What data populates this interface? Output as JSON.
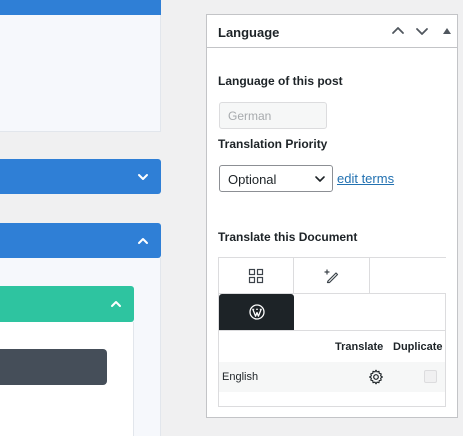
{
  "metabox": {
    "title": "Language",
    "language_label": "Language of this post",
    "language_value": "German",
    "priority_label": "Translation Priority",
    "priority_selected": "Optional",
    "edit_terms_link": "edit terms",
    "translate_label": "Translate this Document",
    "table": {
      "headers": [
        "Translate",
        "Duplicate"
      ],
      "rows": [
        {
          "language": "English",
          "translate_icon": "gear-icon",
          "duplicate_checked": false
        }
      ]
    }
  },
  "icons": {
    "tab1": "grid-icon",
    "tab2": "pen-sparkle-icon",
    "tab3": "wordpress-icon"
  },
  "colors": {
    "accent_blue": "#2f7fd6",
    "accent_green": "#2ec4a0",
    "dark_button": "#454e59",
    "link": "#2271b1"
  }
}
